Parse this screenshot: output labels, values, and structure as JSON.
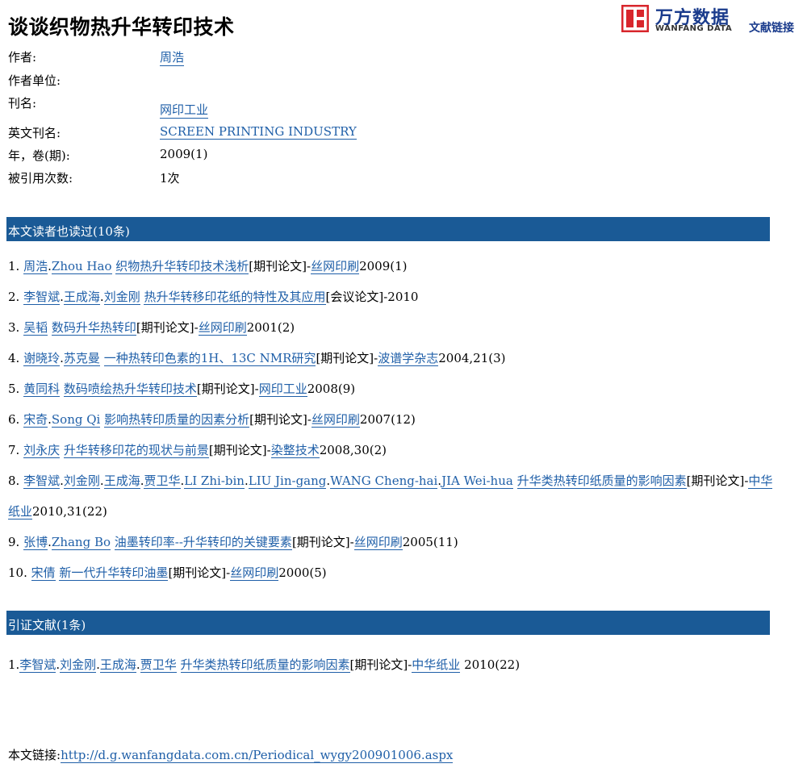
{
  "title": "谈谈织物热升华转印技术",
  "logo": {
    "brand": "万方数据",
    "sub": "WANFANG DATA",
    "link_text": "文献链接",
    "colors": {
      "red": "#d8262c",
      "blue": "#1a3b8c"
    }
  },
  "meta": {
    "author_label": "作者:",
    "author": "周浩",
    "affiliation_label": "作者单位:",
    "journal_label": "刊名:",
    "journal": "网印工业",
    "en_journal_label": "英文刊名:",
    "en_journal": "SCREEN PRINTING INDUSTRY",
    "year_label": "年，卷(期):",
    "year": "2009(1)",
    "cited_label": "被引用次数:",
    "cited": "1次"
  },
  "readers_header": "本文读者也读过(10条)",
  "readers": [
    {
      "num": "1.",
      "authors": [
        "周浩",
        "Zhou Hao"
      ],
      "title": "织物热升华转印技术浅析",
      "type": "[期刊论文]-",
      "source": "丝网印刷",
      "tail": "2009(1)"
    },
    {
      "num": "2.",
      "authors": [
        "李智斌",
        "王成海",
        "刘金刚"
      ],
      "title": "热升华转移印花纸的特性及其应用",
      "type": "[会议论文]-2010",
      "source": "",
      "tail": ""
    },
    {
      "num": "3.",
      "authors": [
        "吴韬"
      ],
      "title": "数码升华热转印",
      "type": "[期刊论文]-",
      "source": "丝网印刷",
      "tail": "2001(2)"
    },
    {
      "num": "4.",
      "authors": [
        "谢晓玲",
        "苏克曼"
      ],
      "title": "一种热转印色素的1H、13C NMR研究",
      "type": "[期刊论文]-",
      "source": "波谱学杂志",
      "tail": "2004,21(3)"
    },
    {
      "num": "5.",
      "authors": [
        "黄同科"
      ],
      "title": "数码喷绘热升华转印技术",
      "type": "[期刊论文]-",
      "source": "网印工业",
      "tail": "2008(9)"
    },
    {
      "num": "6.",
      "authors": [
        "宋奇",
        "Song Qi"
      ],
      "title": "影响热转印质量的因素分析",
      "type": "[期刊论文]-",
      "source": "丝网印刷",
      "tail": "2007(12)"
    },
    {
      "num": "7.",
      "authors": [
        "刘永庆"
      ],
      "title": "升华转移印花的现状与前景",
      "type": "[期刊论文]-",
      "source": "染整技术",
      "tail": "2008,30(2)"
    },
    {
      "num": "8.",
      "authors": [
        "李智斌",
        "刘金刚",
        "王成海",
        "贾卫华",
        "LI Zhi-bin",
        "LIU Jin-gang",
        "WANG Cheng-hai",
        "JIA Wei-hua"
      ],
      "title": "升华类热转印纸质量的影响因素",
      "type": "[期刊论文]-",
      "source": "中华纸业",
      "tail": "2010,31(22)"
    },
    {
      "num": "9.",
      "authors": [
        "张博",
        "Zhang Bo"
      ],
      "title": "油墨转印率--升华转印的关键要素",
      "type": "[期刊论文]-",
      "source": "丝网印刷",
      "tail": "2005(11)"
    },
    {
      "num": "10.",
      "authors": [
        "宋倩"
      ],
      "title": "新一代升华转印油墨",
      "type": "[期刊论文]-",
      "source": "丝网印刷",
      "tail": "2000(5)"
    }
  ],
  "citations_header": "引证文献(1条)",
  "citations": [
    {
      "num": "1.",
      "authors": [
        "李智斌",
        "刘金刚",
        "王成海",
        "贾卫华"
      ],
      "title": "升华类热转印纸质量的影响因素",
      "type": "[期刊论文]-",
      "source": "中华纸业",
      "tail": " 2010(22)"
    }
  ],
  "footer": {
    "label": "本文链接:",
    "url": "http://d.g.wanfangdata.com.cn/Periodical_wygy200901006.aspx"
  }
}
